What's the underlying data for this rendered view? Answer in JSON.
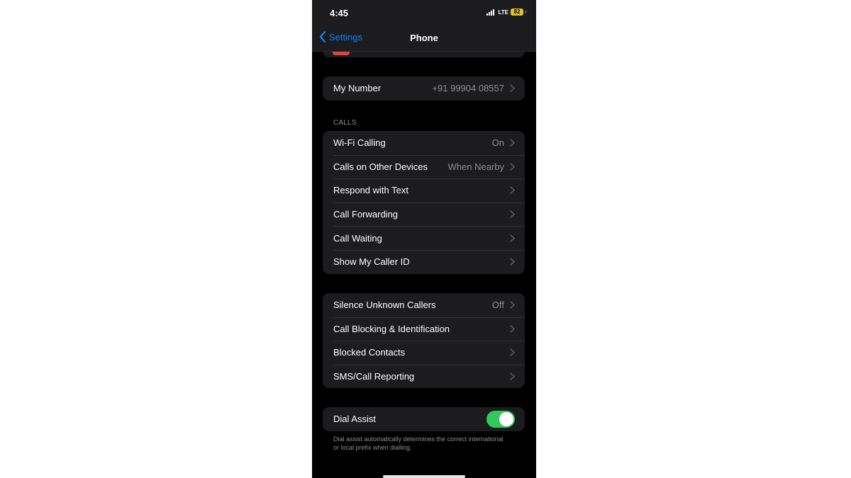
{
  "status_bar": {
    "time": "4:45",
    "network": "LTE",
    "battery": "82",
    "battery_color": "#e6c229"
  },
  "nav": {
    "back_label": "Settings",
    "title": "Phone",
    "back_icon": "chevron-left-icon",
    "accent_color": "#0a84ff"
  },
  "my_number": {
    "label": "My Number",
    "value": "+91 99904 08557"
  },
  "calls_section": {
    "header": "CALLS",
    "rows": [
      {
        "label": "Wi-Fi Calling",
        "value": "On"
      },
      {
        "label": "Calls on Other Devices",
        "value": "When Nearby"
      },
      {
        "label": "Respond with Text",
        "value": ""
      },
      {
        "label": "Call Forwarding",
        "value": ""
      },
      {
        "label": "Call Waiting",
        "value": ""
      },
      {
        "label": "Show My Caller ID",
        "value": ""
      }
    ]
  },
  "blocking_section": {
    "rows": [
      {
        "label": "Silence Unknown Callers",
        "value": "Off"
      },
      {
        "label": "Call Blocking & Identification",
        "value": ""
      },
      {
        "label": "Blocked Contacts",
        "value": ""
      },
      {
        "label": "SMS/Call Reporting",
        "value": ""
      }
    ]
  },
  "dial_assist": {
    "label": "Dial Assist",
    "enabled": true,
    "toggle_color": "#34c759",
    "footnote": "Dial assist automatically determines the correct international or local prefix when dialling."
  }
}
